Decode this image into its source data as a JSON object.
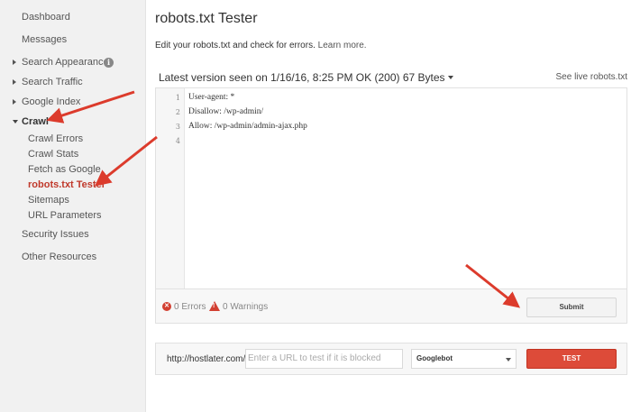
{
  "sidebar": {
    "items": [
      {
        "label": "Dashboard"
      },
      {
        "label": "Messages"
      },
      {
        "label": "Search Appearance"
      },
      {
        "label": "Search Traffic"
      },
      {
        "label": "Google Index"
      },
      {
        "label": "Crawl"
      },
      {
        "label": "Security Issues"
      },
      {
        "label": "Other Resources"
      }
    ],
    "crawl_sub": [
      {
        "label": "Crawl Errors"
      },
      {
        "label": "Crawl Stats"
      },
      {
        "label": "Fetch as Google"
      },
      {
        "label": "robots.txt Tester"
      },
      {
        "label": "Sitemaps"
      },
      {
        "label": "URL Parameters"
      }
    ],
    "info_glyph": "i"
  },
  "main": {
    "title": "robots.txt Tester",
    "description": "Edit your robots.txt and check for errors.",
    "learn_more": "Learn more.",
    "version_label": "Latest version seen on 1/16/16, 8:25 PM OK (200) 67 Bytes",
    "see_live": "See live robots.txt",
    "editor": {
      "line_numbers": [
        "1",
        "2",
        "3",
        "4"
      ],
      "lines": [
        "User-agent: *",
        "Disallow: /wp-admin/",
        "Allow: /wp-admin/admin-ajax.php",
        ""
      ]
    },
    "status": {
      "errors": "0 Errors",
      "warnings": "0 Warnings",
      "error_glyph": "✕",
      "warning_glyph": "!"
    },
    "submit_label": "Submit",
    "test": {
      "url_prefix": "http://hostlater.com/",
      "placeholder": "Enter a URL to test if it is blocked",
      "bot": "Googlebot",
      "test_label": "TEST"
    }
  },
  "colors": {
    "accent_red": "#dd4b39",
    "active_nav": "#c0392b",
    "arrow": "#dc3b2c"
  }
}
